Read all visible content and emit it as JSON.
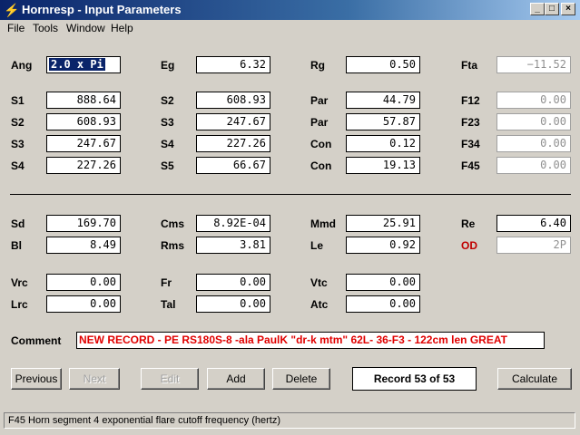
{
  "window": {
    "title": "Hornresp - Input Parameters",
    "min": "_",
    "max": "□",
    "close": "×"
  },
  "menu": [
    "File",
    "Tools",
    "Window",
    "Help"
  ],
  "rows1": [
    {
      "l1": "Ang",
      "v1": "2.0 x Pi",
      "l2": "Eg",
      "v2": "6.32",
      "l3": "Rg",
      "v3": "0.50",
      "l4": "Fta",
      "v4": "−11.52"
    },
    {
      "l1": "S1",
      "v1": "888.64",
      "l2": "S2",
      "v2": "608.93",
      "l3": "Par",
      "v3": "44.79",
      "l4": "F12",
      "v4": "0.00"
    },
    {
      "l1": "S2",
      "v1": "608.93",
      "l2": "S3",
      "v2": "247.67",
      "l3": "Par",
      "v3": "57.87",
      "l4": "F23",
      "v4": "0.00"
    },
    {
      "l1": "S3",
      "v1": "247.67",
      "l2": "S4",
      "v2": "227.26",
      "l3": "Con",
      "v3": "0.12",
      "l4": "F34",
      "v4": "0.00"
    },
    {
      "l1": "S4",
      "v1": "227.26",
      "l2": "S5",
      "v2": "66.67",
      "l3": "Con",
      "v3": "19.13",
      "l4": "F45",
      "v4": "0.00"
    }
  ],
  "rows2": [
    {
      "l1": "Sd",
      "v1": "169.70",
      "l2": "Cms",
      "v2": "8.92E-04",
      "l3": "Mmd",
      "v3": "25.91",
      "l4": "Re",
      "v4": "6.40"
    },
    {
      "l1": "Bl",
      "v1": "8.49",
      "l2": "Rms",
      "v2": "3.81",
      "l3": "Le",
      "v3": "0.92",
      "l4": "OD",
      "v4": "2P"
    },
    {
      "l1": "Vrc",
      "v1": "0.00",
      "l2": "Fr",
      "v2": "0.00",
      "l3": "Vtc",
      "v3": "0.00"
    },
    {
      "l1": "Lrc",
      "v1": "0.00",
      "l2": "Tal",
      "v2": "0.00",
      "l3": "Atc",
      "v3": "0.00"
    }
  ],
  "comment": {
    "label": "Comment",
    "value": "NEW RECORD - PE RS180S-8 -ala PaulK \"dr-k mtm\" 62L- 36-F3 - 122cm len GREAT"
  },
  "buttons": {
    "previous": "Previous",
    "next": "Next",
    "edit": "Edit",
    "add": "Add",
    "delete": "Delete",
    "calculate": "Calculate"
  },
  "record": "Record 53 of 53",
  "status": "F45   Horn segment 4 exponential flare cutoff frequency  (hertz)",
  "colors": {
    "titlebar": "#0a246a",
    "comment_text": "#e00000",
    "od_label": "#c00000"
  }
}
